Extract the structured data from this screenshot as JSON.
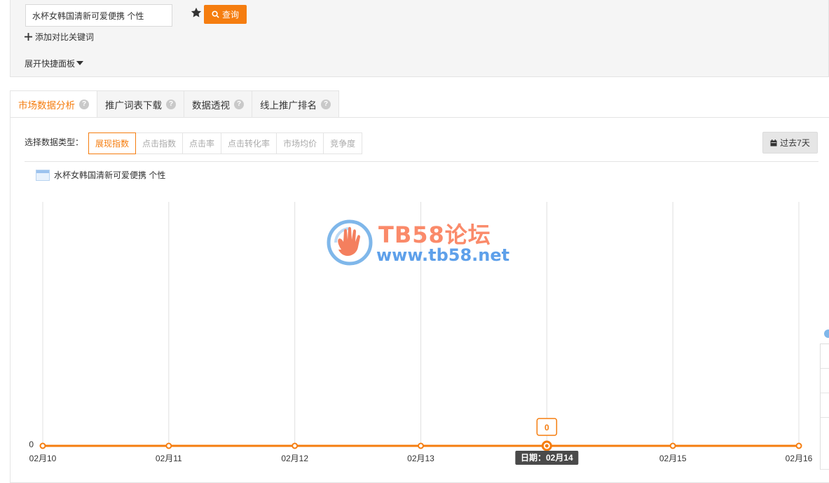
{
  "search": {
    "keyword_value": "水杯女韩国清新可爱便携 个性",
    "button_label": "查询",
    "add_compare_label": "添加对比关键词",
    "expand_label": "展开快捷面板"
  },
  "tabs": [
    {
      "label": "市场数据分析",
      "active": true
    },
    {
      "label": "推广词表下载",
      "active": false
    },
    {
      "label": "数据透视",
      "active": false
    },
    {
      "label": "线上推广排名",
      "active": false
    }
  ],
  "data_type": {
    "label": "选择数据类型：",
    "options": [
      "展现指数",
      "点击指数",
      "点击率",
      "点击转化率",
      "市场均价",
      "竞争度"
    ],
    "selected": "展现指数"
  },
  "date_range": {
    "label": "过去7天"
  },
  "legend": {
    "series_name": "水杯女韩国清新可爱便携 个性",
    "swatch_color": "#9cc3ef"
  },
  "watermark": {
    "title": "TB58论坛",
    "url": "www.tb58.net"
  },
  "chart_data": {
    "type": "line",
    "categories": [
      "02月10",
      "02月11",
      "02月12",
      "02月13",
      "02月14",
      "02月15",
      "02月16"
    ],
    "series": [
      {
        "name": "水杯女韩国清新可爱便携 个性",
        "values": [
          0,
          0,
          0,
          0,
          0,
          0,
          0
        ],
        "color": "#f57d0f"
      }
    ],
    "y_tick_labels": [
      "0"
    ],
    "ylim": [
      0,
      1
    ],
    "grid": "vertical",
    "tooltip": {
      "value": "0",
      "date_label": "日期：02月14",
      "index": 4
    }
  },
  "colors": {
    "accent": "#f57d0f",
    "grid": "#e0e0e0",
    "panel_bg": "#f5f5f5"
  }
}
